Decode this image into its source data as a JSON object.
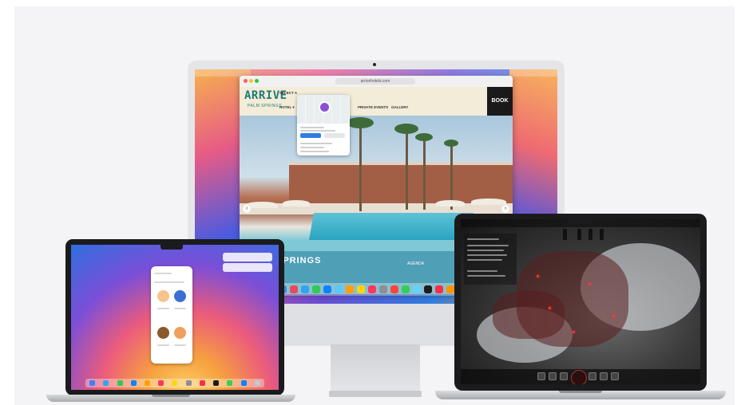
{
  "imac": {
    "website": {
      "url": "arrivehotels.com",
      "logo": "ARRIVE",
      "logo_sub": "PALM SPRINGS",
      "nav": [
        "SELECT A",
        "HOTEL ▾",
        "PRIVATE EVENTS",
        "GALLERY"
      ],
      "book_label": "BOOK",
      "hero_caption": "SPRINGS",
      "footer_link": "AGENDA"
    }
  },
  "colors": {
    "site_teal": "#1f7a77",
    "site_band": "#4f9fb6",
    "map_pin": "#8a4fd8"
  }
}
